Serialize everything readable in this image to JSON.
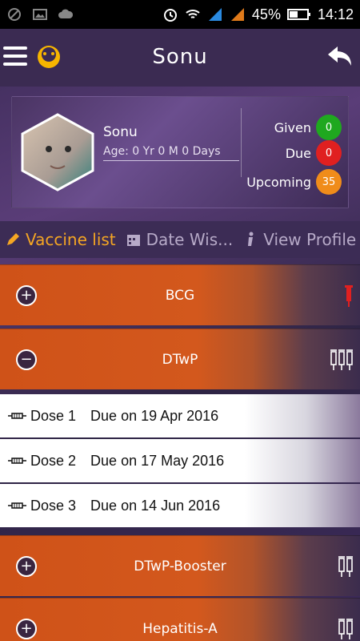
{
  "status_bar": {
    "battery": "45%",
    "time": "14:12"
  },
  "app_bar": {
    "title": "Sonu"
  },
  "profile": {
    "name": "Sonu",
    "age": "Age: 0 Yr 0 M 0 Days",
    "stats": [
      {
        "label": "Given",
        "count": "0",
        "color": "#1fa81f"
      },
      {
        "label": "Due",
        "count": "0",
        "color": "#e02020"
      },
      {
        "label": "Upcoming",
        "count": "35",
        "color": "#f08c1a"
      }
    ]
  },
  "tabs": [
    {
      "label": "Vaccine list",
      "active": true,
      "icon": "pencil-icon"
    },
    {
      "label": "Date Wis...",
      "active": false,
      "icon": "calendar-icon"
    },
    {
      "label": "View Profile",
      "active": false,
      "icon": "info-icon"
    }
  ],
  "groups": [
    {
      "name": "BCG",
      "toggle": "+",
      "icon": "single-syringe-icon"
    },
    {
      "name": "DTwP",
      "toggle": "−",
      "icon": "triple-syringe-icon"
    },
    {
      "name": "DTwP-Booster",
      "toggle": "+",
      "icon": "double-syringe-icon"
    },
    {
      "name": "Hepatitis-A",
      "toggle": "+",
      "icon": "double-syringe-icon"
    }
  ],
  "doses": [
    {
      "label": "Dose 1",
      "due": "Due on 19 Apr 2016"
    },
    {
      "label": "Dose 2",
      "due": "Due on 17 May 2016"
    },
    {
      "label": "Dose 3",
      "due": "Due on 14 Jun 2016"
    }
  ]
}
